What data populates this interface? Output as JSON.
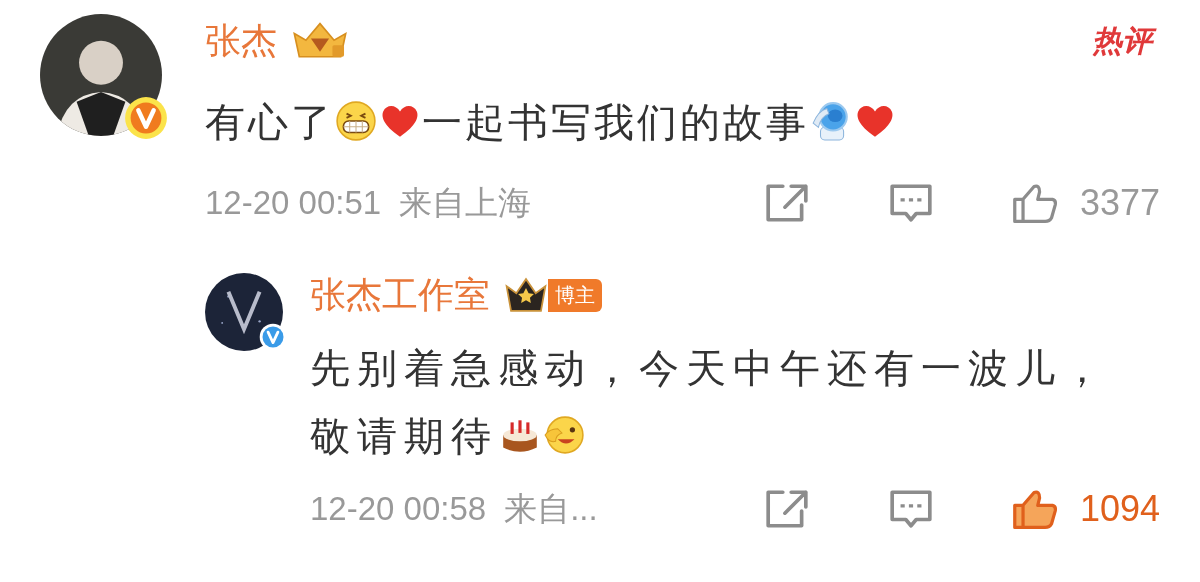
{
  "comments": [
    {
      "author": "张杰",
      "hot_label": "热评",
      "content": [
        {
          "kind": "text",
          "text": "有心了"
        },
        {
          "kind": "grin"
        },
        {
          "kind": "heart"
        },
        {
          "kind": "text",
          "text": "一起书写我们的故事"
        },
        {
          "kind": "salute"
        },
        {
          "kind": "heart"
        }
      ],
      "time": "12-20 00:51",
      "location": "来自上海",
      "likes": "3377",
      "liked": false,
      "replies": [
        {
          "author": "张杰工作室",
          "role_badge": "博主",
          "content": [
            {
              "kind": "text",
              "text": "先别着急感动，今天中午还有一波儿，"
            },
            {
              "kind": "text",
              "text": "敬请期待"
            },
            {
              "kind": "cake"
            },
            {
              "kind": "wink"
            }
          ],
          "time": "12-20 00:58",
          "location": "来自...",
          "likes": "1094",
          "liked": true
        }
      ]
    }
  ]
}
